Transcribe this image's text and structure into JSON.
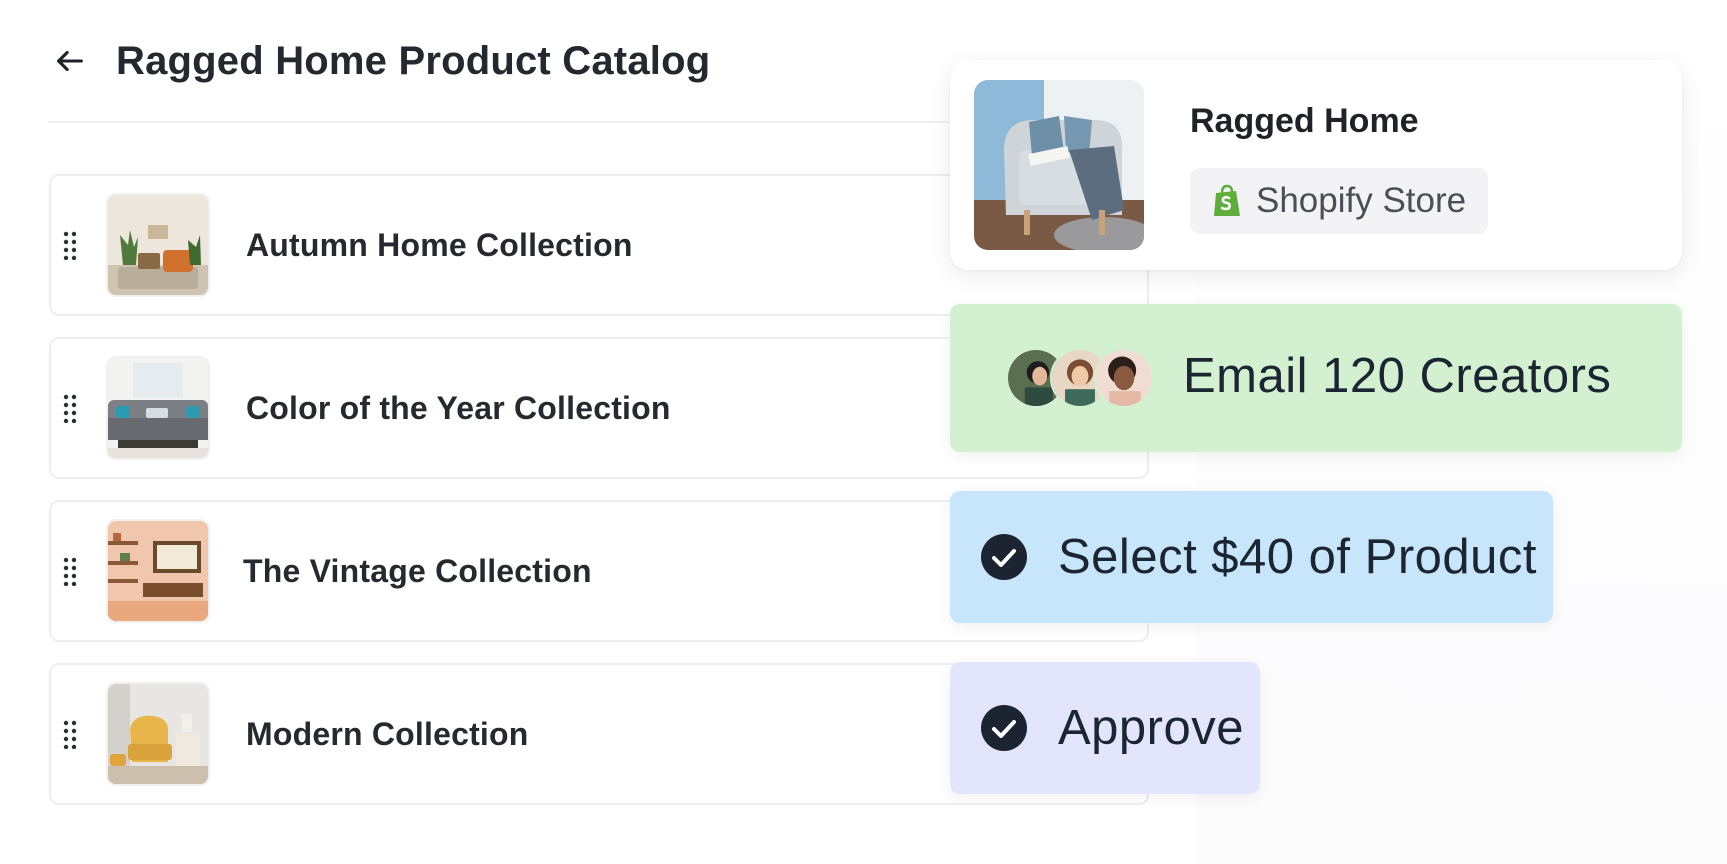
{
  "header": {
    "title": "Ragged Home Product Catalog",
    "back_icon": "arrow-left-icon"
  },
  "collections": [
    {
      "name": "Autumn Home Collection",
      "thumbnail": "autumn-living-room-image"
    },
    {
      "name": "Color of the Year Collection",
      "thumbnail": "grey-sofa-room-image"
    },
    {
      "name": "The Vintage Collection",
      "thumbnail": "vintage-shelves-image"
    },
    {
      "name": "Modern Collection",
      "thumbnail": "yellow-armchair-image"
    }
  ],
  "store": {
    "name": "Ragged Home",
    "badge_label": "Shopify Store",
    "badge_icon": "shopify-bag-icon"
  },
  "actions": {
    "email_label": "Email 120 Creators",
    "select_label": "Select $40 of Product",
    "approve_label": "Approve"
  },
  "colors": {
    "email_bg": "#d3f0d1",
    "select_bg": "#c7e5fb",
    "approve_bg": "#e3e5fd",
    "check_fill": "#1b2430",
    "shopify_green": "#5fae3c"
  }
}
